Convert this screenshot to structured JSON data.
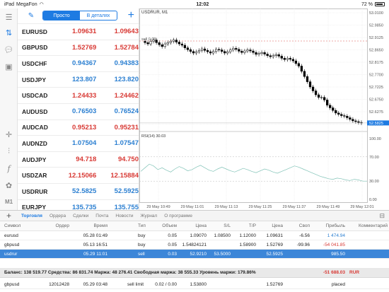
{
  "status": {
    "carrier": "iPad",
    "network": "MegaFon",
    "time": "12:02",
    "battery": "72 %"
  },
  "toolbar": {
    "items": [
      "quotes-icon",
      "trade-icon",
      "chat-icon",
      "news-icon",
      "crosshair-icon",
      "indicators-icon",
      "function-icon",
      "objects-icon"
    ],
    "timeframe": "M1"
  },
  "quotes": {
    "tab_simple": "Просто",
    "tab_details": "В деталях",
    "rows": [
      {
        "symbol": "EURUSD",
        "bid": "1.09631",
        "ask": "1.09643",
        "color": "red"
      },
      {
        "symbol": "GBPUSD",
        "bid": "1.52769",
        "ask": "1.52784",
        "color": "red"
      },
      {
        "symbol": "USDCHF",
        "bid": "0.94367",
        "ask": "0.94383",
        "color": "blue"
      },
      {
        "symbol": "USDJPY",
        "bid": "123.807",
        "ask": "123.820",
        "color": "blue"
      },
      {
        "symbol": "USDCAD",
        "bid": "1.24433",
        "ask": "1.24462",
        "color": "red"
      },
      {
        "symbol": "AUDUSD",
        "bid": "0.76503",
        "ask": "0.76524",
        "color": "blue"
      },
      {
        "symbol": "AUDCAD",
        "bid": "0.95213",
        "ask": "0.95231",
        "color": "red"
      },
      {
        "symbol": "AUDNZD",
        "bid": "1.07504",
        "ask": "1.07547",
        "color": "blue"
      },
      {
        "symbol": "AUDJPY",
        "bid": "94.718",
        "ask": "94.750",
        "color": "red"
      },
      {
        "symbol": "USDZAR",
        "bid": "12.15066",
        "ask": "12.15884",
        "color": "red"
      },
      {
        "symbol": "USDRUR",
        "bid": "52.5825",
        "ask": "52.5925",
        "color": "blue"
      },
      {
        "symbol": "EURJPY",
        "bid": "135.735",
        "ask": "135.755",
        "color": "blue"
      }
    ]
  },
  "chart": {
    "title": "USDRUR, M1",
    "order_label": "sell 0.03",
    "indicator_label": "RSI(14) 30.03",
    "price_ticks": [
      "53.0100",
      "52.9850",
      "52.9125",
      "52.8650",
      "52.8175",
      "52.7700",
      "52.7225",
      "52.6750",
      "52.6275",
      "52.5800"
    ],
    "current_price": "52.5825",
    "rsi_ticks": [
      "100.00",
      "70.00",
      "30.00",
      "0.00"
    ],
    "time_ticks": [
      "29 May 10:49",
      "29 May 11:01",
      "29 May 11:13",
      "29 May 11:25",
      "29 May 11:37",
      "29 May 11:49",
      "29 May 12:01"
    ]
  },
  "terminal": {
    "tabs": [
      "Торговля",
      "Ордера",
      "Сделки",
      "Почта",
      "Новости",
      "Журнал",
      "О программе"
    ],
    "columns": [
      "Символ",
      "Ордер",
      "Время",
      "Тип",
      "Объем",
      "Цена",
      "S/L",
      "T/P",
      "Цена",
      "Своп",
      "Прибыль",
      "Комментарий"
    ],
    "positions": [
      {
        "symbol": "eurusd",
        "order": "",
        "time": "05.28 01:49",
        "type": "buy",
        "volume": "0.05",
        "price": "1.09070",
        "sl": "1.08500",
        "tp": "1.12000",
        "current": "1.09631",
        "swap": "-6.56",
        "profit": "1 474.94",
        "comment": ""
      },
      {
        "symbol": "gbpusd",
        "order": "",
        "time": "05.13 16:51",
        "type": "buy",
        "volume": "0.05",
        "price": "1.54824121",
        "sl": "",
        "tp": "1.58900",
        "current": "1.52769",
        "swap": "-99.96",
        "profit": "-54 041.85",
        "comment": ""
      },
      {
        "symbol": "usdrur",
        "order": "",
        "time": "05.29 11:01",
        "type": "sell",
        "volume": "0.03",
        "price": "52.9210",
        "sl": "53.5000",
        "tp": "",
        "current": "52.5925",
        "swap": "",
        "profit": "985.50",
        "comment": ""
      }
    ],
    "balance_line": "Баланс: 138 519.77 Средства: 86 831.74 Маржа: 48 276.41 Свободная маржа: 38 555.33 Уровень маржи: 179.86%",
    "total_profit": "-51 688.03",
    "currency": "RUR",
    "pending": {
      "symbol": "gbpusd",
      "order": "12012428",
      "time": "05.29 03:48",
      "type": "sell limit",
      "volume": "0.02 / 0.00",
      "price": "1.53800",
      "current": "1.52769",
      "status": "placed"
    }
  },
  "colors": {
    "accent": "#1e7be2",
    "bid_red": "#d83a35",
    "bid_blue": "#2b7fd1",
    "selected_row": "#3c86d8"
  }
}
